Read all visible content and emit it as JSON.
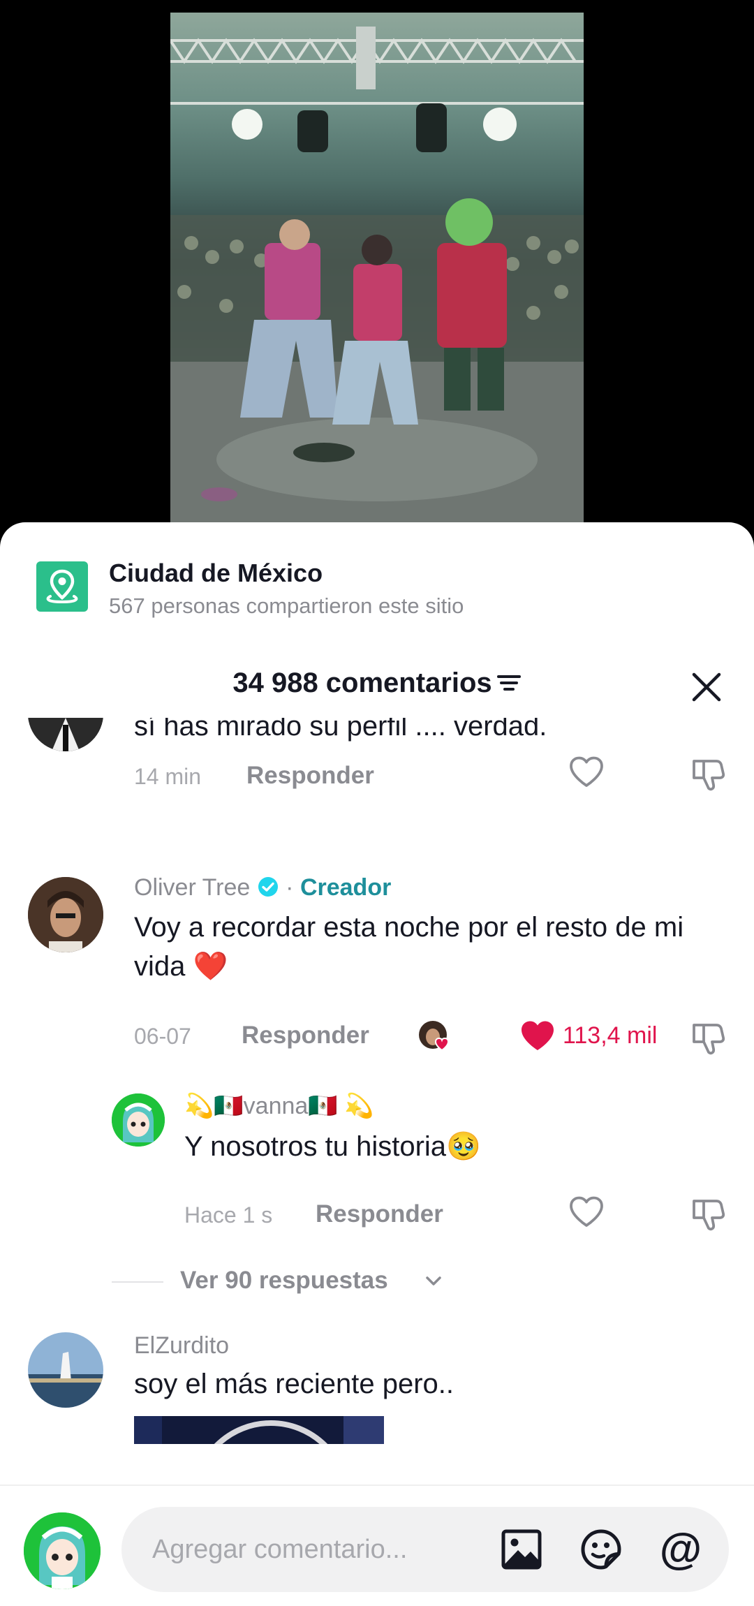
{
  "location": {
    "title": "Ciudad de México",
    "subtitle": "567 personas compartieron este sitio",
    "icon": "location-pin-icon",
    "color": "#2bbf8b"
  },
  "comments_header": {
    "count_label": "34 988 comentarios"
  },
  "comments": [
    {
      "text": "sí has mirado su perfil .... verdad.",
      "time": "14 min",
      "reply_label": "Responder"
    },
    {
      "username": "Oliver Tree",
      "verified": true,
      "separator": "·",
      "badge": "Creador",
      "text": "Voy a recordar esta noche por el resto de mi vida ❤️",
      "time": "06-07",
      "reply_label": "Responder",
      "liked": true,
      "like_count": "113,4 mil"
    },
    {
      "username": "💫🇲🇽vanna🇲🇽 💫",
      "text": "Y nosotros tu historia🥹",
      "time": "Hace 1 s",
      "reply_label": "Responder"
    },
    {
      "username": "ElZurdito",
      "text": "soy el más reciente pero.."
    }
  ],
  "view_replies_label": "Ver 90 respuestas",
  "bottom_bar": {
    "input_placeholder": "Agregar comentario...",
    "icons": [
      "image-icon",
      "sticker-icon",
      "mention-icon"
    ],
    "mention_symbol": "@"
  },
  "colors": {
    "like_red": "#e0144c",
    "creator_teal": "#1e8f9b",
    "verified_blue": "#20d5ec"
  }
}
